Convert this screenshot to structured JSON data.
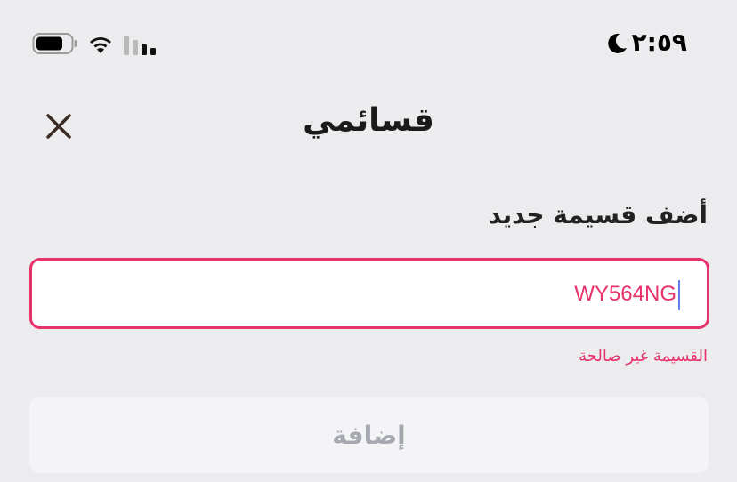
{
  "status_bar": {
    "time": "٢:٥٩",
    "icons": [
      "moon-icon",
      "battery-icon",
      "wifi-icon",
      "signal-icon"
    ]
  },
  "header": {
    "title": "قسائمي",
    "close_icon": "close-icon"
  },
  "form": {
    "label": "أضف قسيمة جديد",
    "input_value": "WY564NG",
    "error_message": "القسيمة غير صالحة",
    "submit_label": "إضافة"
  },
  "colors": {
    "background": "#ECECEE",
    "error": "#E8336A",
    "caret": "#5B7FE6",
    "button_bg": "#F4F4F6",
    "button_text_disabled": "#A6AAB0"
  }
}
